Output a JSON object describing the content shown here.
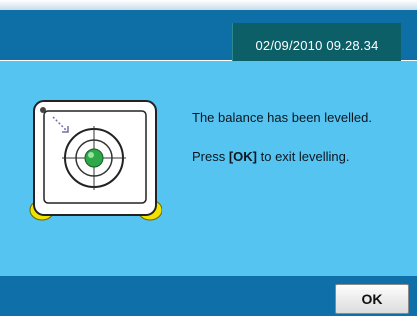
{
  "header": {
    "datetime": "02/09/2010 09.28.34"
  },
  "message": {
    "line1": "The balance has been levelled.",
    "line2_prefix": "Press ",
    "line2_key": "[OK]",
    "line2_suffix": " to exit levelling."
  },
  "footer": {
    "ok_label": "OK"
  },
  "colors": {
    "header": "#0d6fa6",
    "datetime_box": "#0c5f66",
    "content_bg": "#55c4f0",
    "footer": "#0f6fa8",
    "level_bubble": "#2fa84a",
    "feet": "#f2e200"
  },
  "icons": {
    "illustration": "balance-level-indicator-icon"
  }
}
